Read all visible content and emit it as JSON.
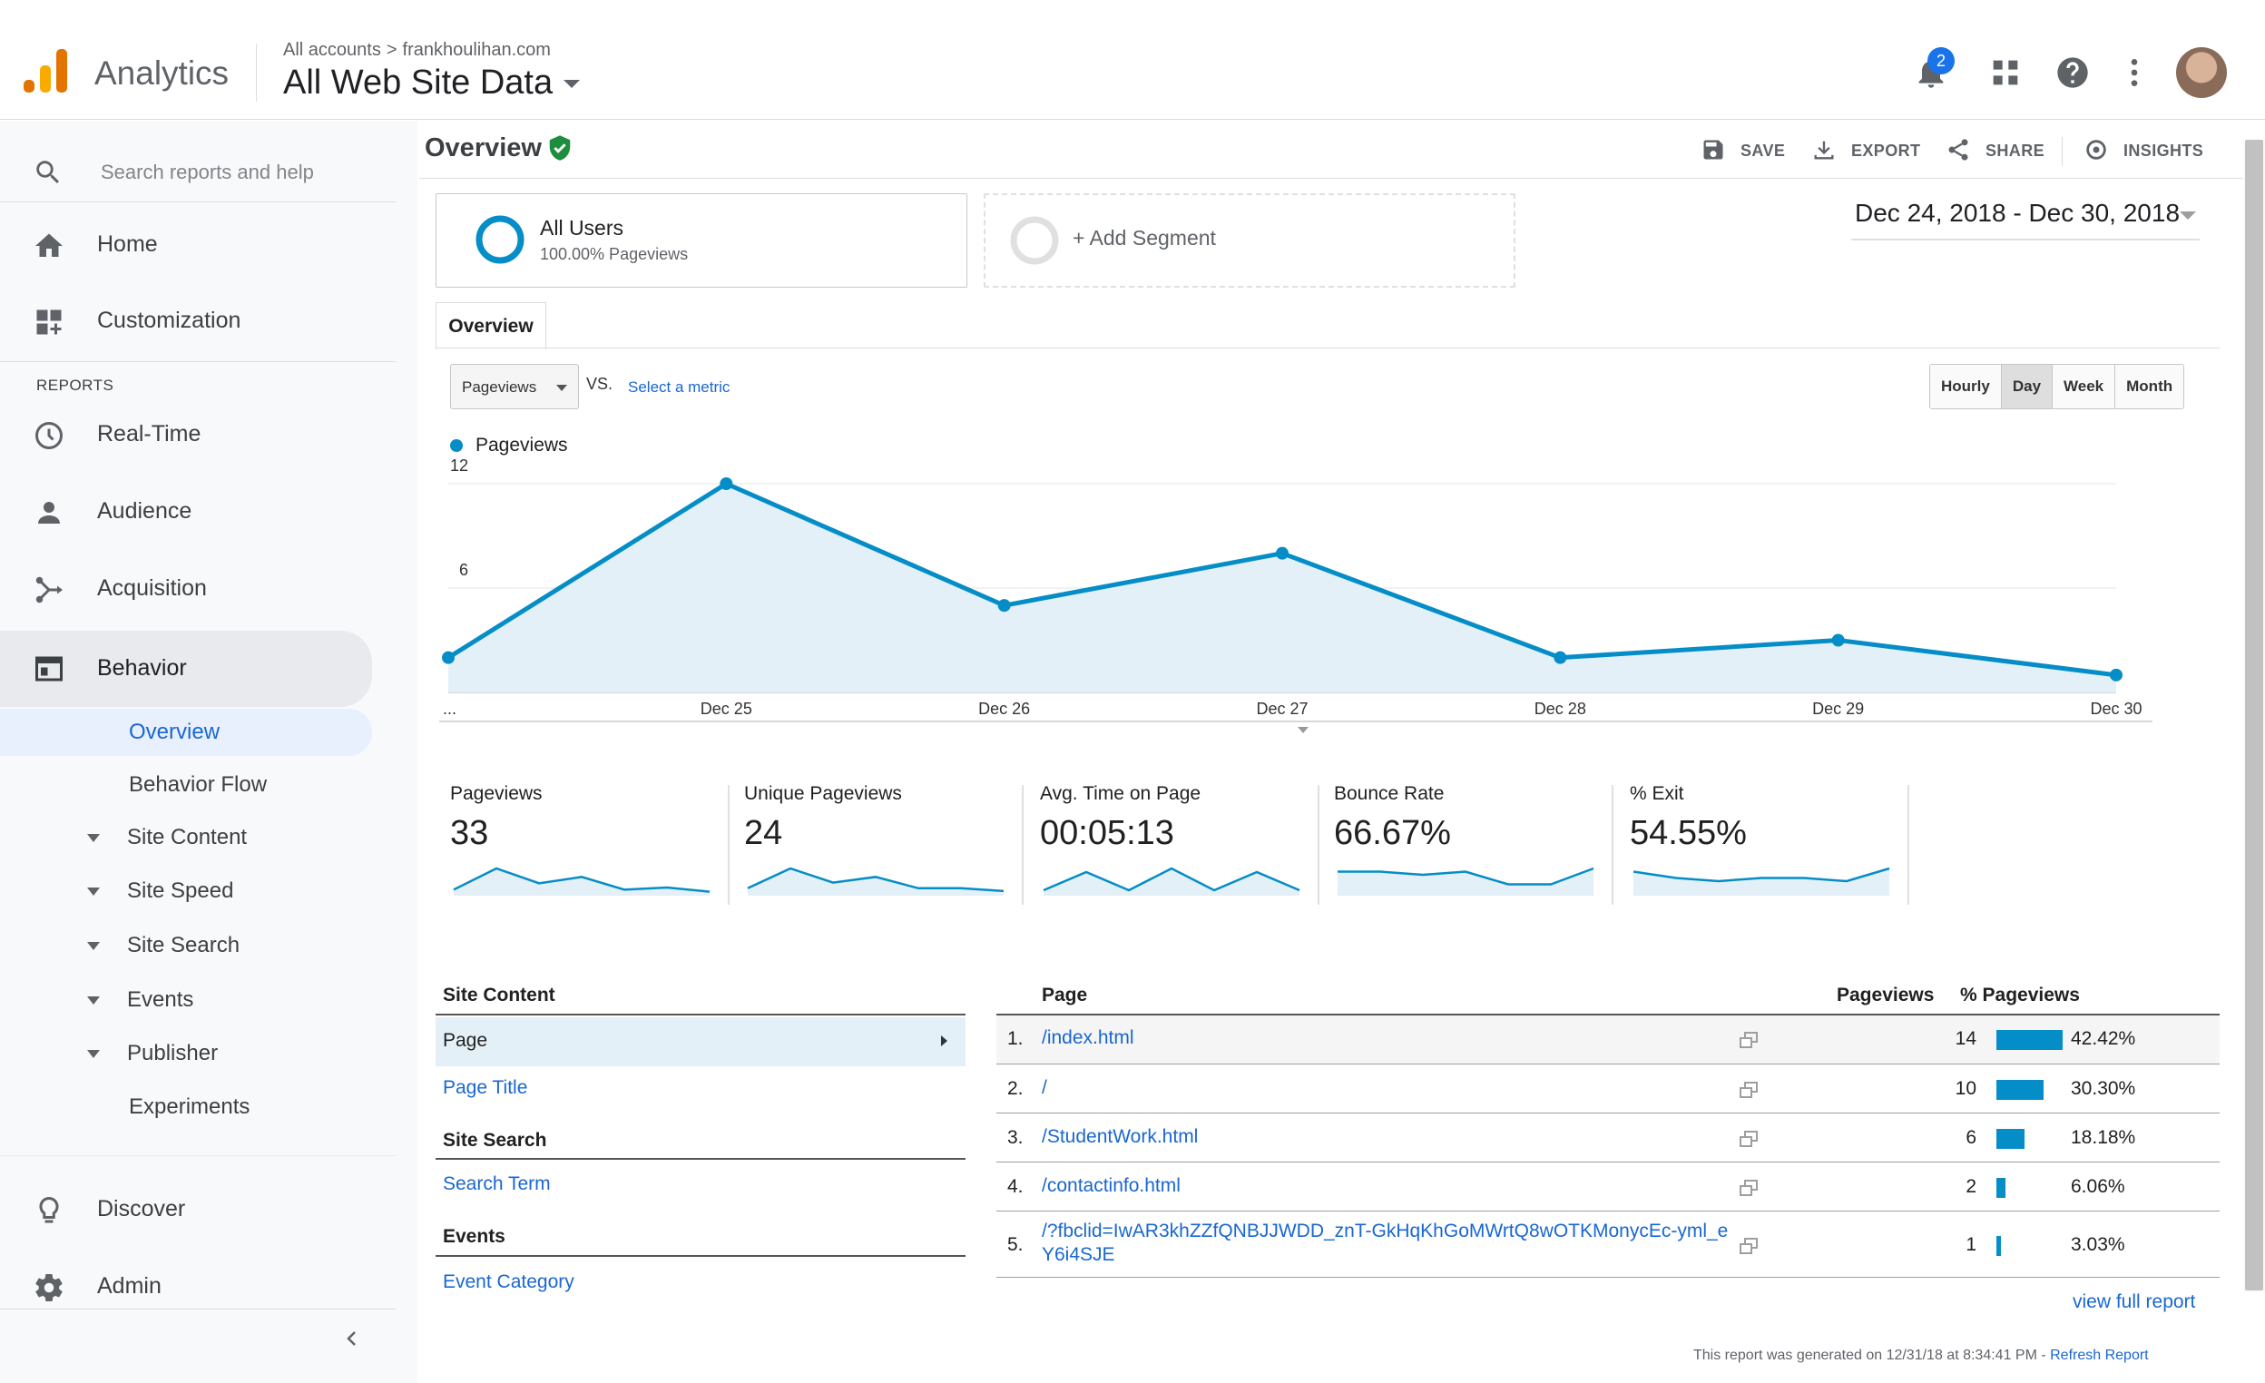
{
  "header": {
    "brand": "Analytics",
    "breadcrumb_all": "All accounts",
    "breadcrumb_sep": ">",
    "breadcrumb_account": "frankhoulihan.com",
    "property": "All Web Site Data",
    "notification_count": "2"
  },
  "sidebar": {
    "search_placeholder": "Search reports and help",
    "home": "Home",
    "customization": "Customization",
    "reports_label": "REPORTS",
    "realtime": "Real-Time",
    "audience": "Audience",
    "acquisition": "Acquisition",
    "behavior": "Behavior",
    "sub": {
      "overview": "Overview",
      "behavior_flow": "Behavior Flow",
      "site_content": "Site Content",
      "site_speed": "Site Speed",
      "site_search": "Site Search",
      "events": "Events",
      "publisher": "Publisher",
      "experiments": "Experiments"
    },
    "discover": "Discover",
    "admin": "Admin"
  },
  "main": {
    "title": "Overview",
    "toolbar": {
      "save": "SAVE",
      "export": "EXPORT",
      "share": "SHARE",
      "insights": "INSIGHTS"
    },
    "segment": {
      "name": "All Users",
      "detail": "100.00% Pageviews",
      "add": "+ Add Segment"
    },
    "date_range": "Dec 24, 2018 - Dec 30, 2018",
    "tab": "Overview",
    "metric_select": "Pageviews",
    "vs": "VS.",
    "select_metric": "Select a metric",
    "granularity": [
      "Hourly",
      "Day",
      "Week",
      "Month"
    ],
    "granularity_selected": "Day"
  },
  "chart_data": {
    "type": "area",
    "series": [
      {
        "name": "Pageviews",
        "values": [
          2,
          12,
          5,
          8,
          2,
          3,
          1
        ]
      }
    ],
    "categories": [
      "...",
      "Dec 25",
      "Dec 26",
      "Dec 27",
      "Dec 28",
      "Dec 29",
      "Dec 30"
    ],
    "y_ticks": [
      "6",
      "12"
    ],
    "ylim": [
      0,
      12
    ],
    "color": "#058dc7",
    "fill": "#e3f0f7",
    "grid": true,
    "legend": "top-left"
  },
  "scorecards": [
    {
      "name": "Pageviews",
      "value": "33",
      "spark": [
        2,
        12,
        5,
        8,
        2,
        3,
        1
      ]
    },
    {
      "name": "Unique Pageviews",
      "value": "24",
      "spark": [
        2,
        9,
        4,
        6,
        2,
        2,
        1
      ]
    },
    {
      "name": "Avg. Time on Page",
      "value": "00:05:13",
      "spark": [
        1,
        6,
        1,
        7,
        1,
        6,
        1
      ]
    },
    {
      "name": "Bounce Rate",
      "value": "66.67%",
      "spark": [
        7,
        7,
        6,
        7,
        3,
        3,
        8
      ]
    },
    {
      "name": "% Exit",
      "value": "54.55%",
      "spark": [
        7,
        5,
        4,
        5,
        5,
        4,
        8
      ]
    }
  ],
  "site_content": {
    "heading": "Site Content",
    "page": "Page",
    "page_title": "Page Title",
    "search_heading": "Site Search",
    "search_term": "Search Term",
    "events_heading": "Events",
    "event_category": "Event Category"
  },
  "table": {
    "col_page": "Page",
    "col_pageviews": "Pageviews",
    "col_pct": "% Pageviews",
    "rows": [
      {
        "idx": "1.",
        "page": "/index.html",
        "pageviews": "14",
        "pct": "42.42%",
        "share": 0.4242
      },
      {
        "idx": "2.",
        "page": "/",
        "pageviews": "10",
        "pct": "30.30%",
        "share": 0.303
      },
      {
        "idx": "3.",
        "page": "/StudentWork.html",
        "pageviews": "6",
        "pct": "18.18%",
        "share": 0.1818
      },
      {
        "idx": "4.",
        "page": "/contactinfo.html",
        "pageviews": "2",
        "pct": "6.06%",
        "share": 0.0606
      },
      {
        "idx": "5.",
        "page": "/?fbclid=IwAR3khZZfQNBJJWDD_znT-GkHqKhGoMWrtQ8wOTKMonycEc-yml_eY6i4SJE",
        "pageviews": "1",
        "pct": "3.03%",
        "share": 0.0303
      }
    ],
    "view_full": "view full report",
    "generated": "This report was generated on 12/31/18 at 8:34:41 PM - ",
    "refresh": "Refresh Report"
  }
}
